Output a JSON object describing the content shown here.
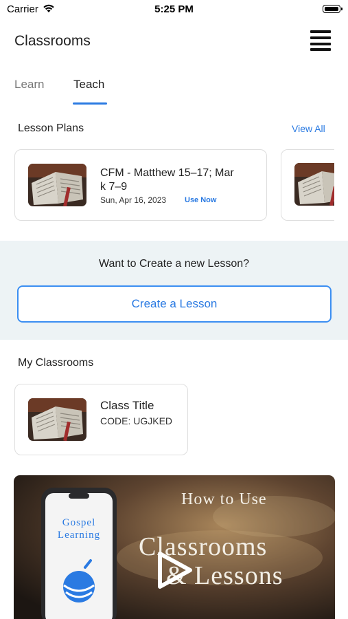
{
  "status_bar": {
    "carrier": "Carrier",
    "time": "5:25 PM"
  },
  "header": {
    "title": "Classrooms",
    "menu_icon": "hamburger-menu-icon"
  },
  "tabs": [
    {
      "label": "Learn",
      "active": false
    },
    {
      "label": "Teach",
      "active": true
    }
  ],
  "lesson_plans": {
    "heading": "Lesson Plans",
    "view_all": "View All",
    "items": [
      {
        "title": "CFM - Matthew 15–17; Mar k 7–9",
        "title_line1": "CFM - Matthew 15–17; Mar",
        "title_line2": "k 7–9",
        "date": "Sun, Apr 16, 2023",
        "action": "Use Now"
      }
    ]
  },
  "create_lesson": {
    "prompt": "Want to Create a new Lesson?",
    "button": "Create a Lesson"
  },
  "my_classrooms": {
    "heading": "My Classrooms",
    "items": [
      {
        "title": "Class Title",
        "code": "CODE: UGJKED"
      }
    ]
  },
  "video": {
    "phone_text_line1": "Gospel",
    "phone_text_line2": "Learning",
    "line1": "How to Use",
    "line2": "Classrooms",
    "line3": "& Lessons",
    "play_icon": "play-icon"
  },
  "colors": {
    "accent": "#2a7ae2",
    "banner_bg": "#edf3f5"
  }
}
